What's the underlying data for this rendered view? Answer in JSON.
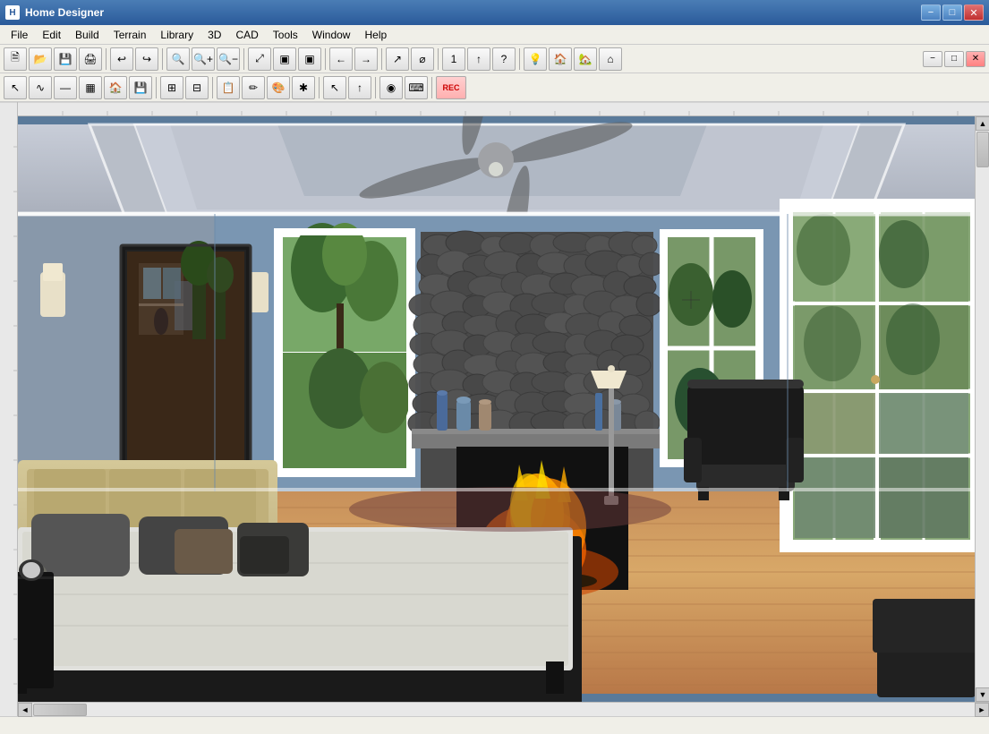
{
  "app": {
    "title": "Home Designer",
    "icon": "HD"
  },
  "titlebar": {
    "minimize": "−",
    "maximize": "□",
    "close": "✕",
    "inner_minimize": "−",
    "inner_maximize": "□",
    "inner_close": "✕"
  },
  "menubar": {
    "items": [
      "File",
      "Edit",
      "Build",
      "Terrain",
      "Library",
      "3D",
      "CAD",
      "Tools",
      "Window",
      "Help"
    ]
  },
  "toolbar1": {
    "buttons": [
      "🗎",
      "📂",
      "💾",
      "🖨",
      "↩",
      "↪",
      "🔍",
      "🔍+",
      "🔍-",
      "⤢",
      "▣",
      "▣",
      "⟨",
      "⟩",
      "↗",
      "⌀",
      "1",
      "↑",
      "?",
      "💡",
      "🏠",
      "🏡",
      "⌂"
    ]
  },
  "toolbar2": {
    "buttons": [
      "↖",
      "〜",
      "—",
      "▦",
      "🏠",
      "💾",
      "⊞",
      "⊟",
      "📋",
      "✏",
      "🎨",
      "✱",
      "↖",
      "↑",
      "◉",
      "⌨",
      "REC"
    ]
  },
  "statusbar": {
    "text": ""
  },
  "viewport": {
    "scene": "3D bedroom view with fireplace, bed, and windows"
  }
}
